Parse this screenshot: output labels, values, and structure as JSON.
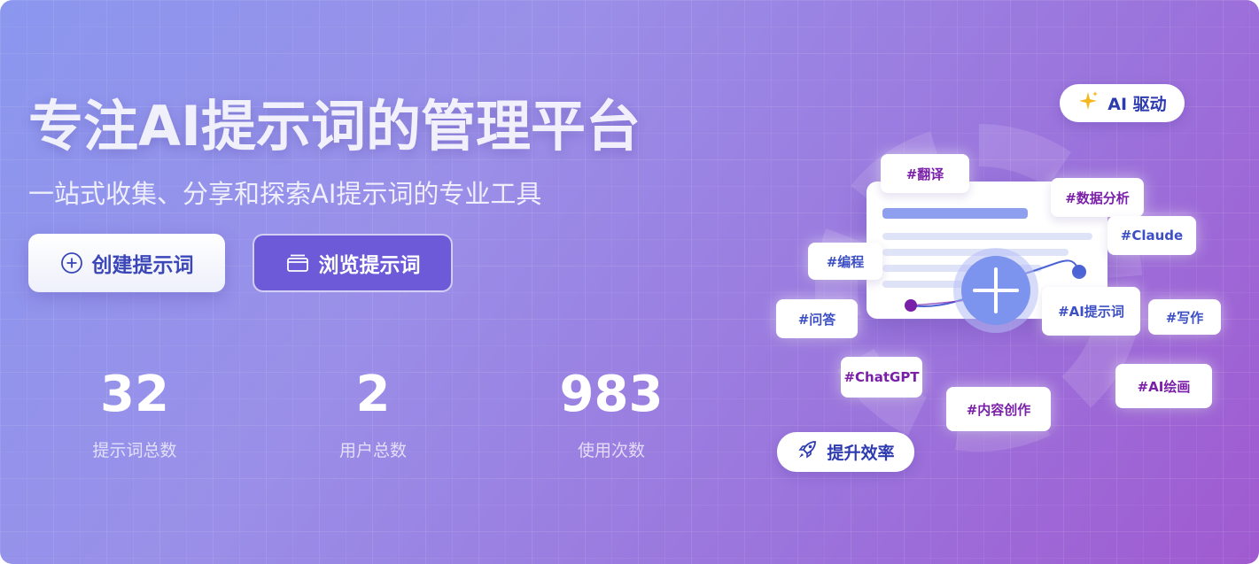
{
  "hero": {
    "title": "专注AI提示词的管理平台",
    "subtitle": "一站式收集、分享和探索AI提示词的专业工具"
  },
  "buttons": {
    "create_label": "创建提示词",
    "browse_label": "浏览提示词"
  },
  "stats": [
    {
      "value": "32",
      "label": "提示词总数"
    },
    {
      "value": "2",
      "label": "用户总数"
    },
    {
      "value": "983",
      "label": "使用次数"
    }
  ],
  "illustration": {
    "badge_ai": "AI 驱动",
    "badge_efficiency": "提升效率",
    "tags": {
      "translate": "#翻译",
      "data_analysis": "#数据分析",
      "claude": "#Claude",
      "coding": "#编程",
      "qa": "#问答",
      "ai_prompt": "#AI提示词",
      "writing": "#写作",
      "chatgpt": "#ChatGPT",
      "content": "#内容创作",
      "ai_painting": "#AI绘画"
    }
  },
  "colors": {
    "accent_blue": "#3b46b8",
    "browse_button": "#6d5ad9",
    "tag_purple": "#7a1fa8",
    "tag_blue": "#3d4fc4"
  }
}
